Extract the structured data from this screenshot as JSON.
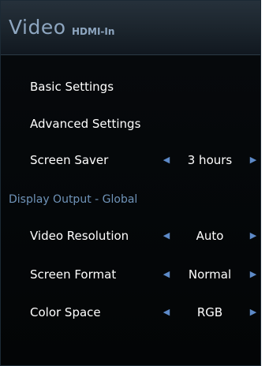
{
  "header": {
    "title": "Video",
    "subtitle": "HDMI-In"
  },
  "menu": {
    "basic_settings": "Basic Settings",
    "advanced_settings": "Advanced Settings",
    "screen_saver": {
      "label": "Screen Saver",
      "value": "3 hours"
    },
    "section_display_output": "Display Output - Global",
    "video_resolution": {
      "label": "Video Resolution",
      "value": "Auto"
    },
    "screen_format": {
      "label": "Screen Format",
      "value": "Normal"
    },
    "color_space": {
      "label": "Color Space",
      "value": "RGB"
    }
  },
  "icons": {
    "left": "◀",
    "right": "▶"
  },
  "colors": {
    "title": "#8ea6c0",
    "section": "#6f93b8",
    "arrow": "#5d8ac8",
    "text": "#ffffff"
  }
}
